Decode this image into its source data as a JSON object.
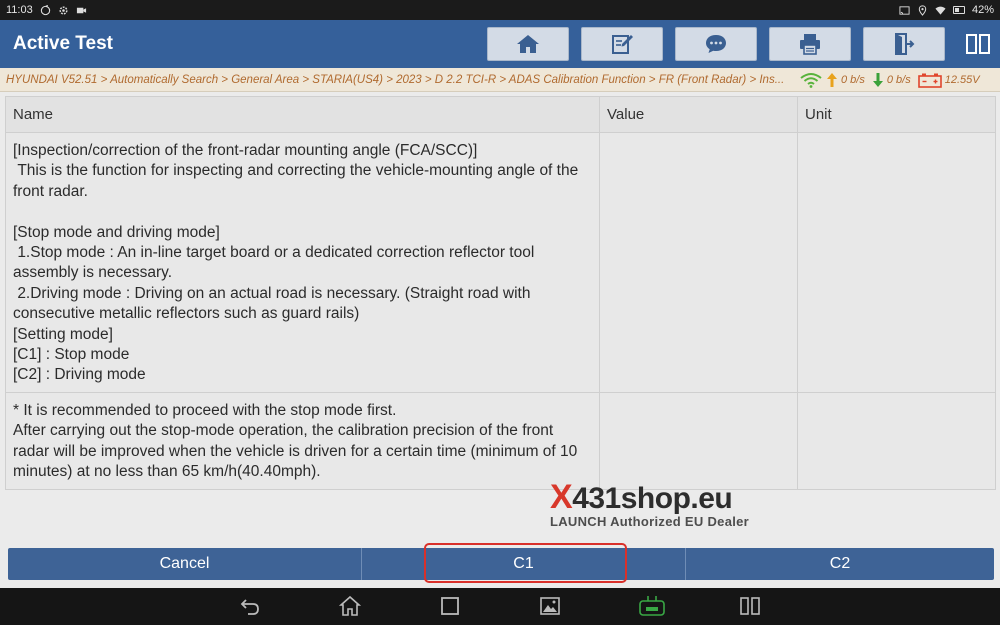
{
  "status_bar": {
    "time": "11:03",
    "battery": "42%"
  },
  "header": {
    "title": "Active Test",
    "toolbar": {
      "home_icon": "home-icon",
      "edit_icon": "edit-note-icon",
      "feedback_icon": "chat-bubble-icon",
      "print_icon": "printer-icon",
      "exit_icon": "exit-icon",
      "split_icon": "split-screen-icon"
    }
  },
  "breadcrumb": {
    "path": "HYUNDAI V52.51 > Automatically Search > General Area > STARIA(US4) > 2023 > D 2.2 TCI-R > ADAS Calibration Function > FR (Front Radar) > Ins...",
    "upload_speed": "0 b/s",
    "download_speed": "0 b/s",
    "voltage": "12.55V"
  },
  "table": {
    "columns": [
      "Name",
      "Value",
      "Unit"
    ],
    "rows": [
      {
        "name": "[Inspection/correction of the front-radar mounting angle (FCA/SCC)]\n This is the function for inspecting and correcting the vehicle-mounting angle of the front radar.\n\n[Stop mode and driving mode]\n 1.Stop mode : An in-line target board or a dedicated correction reflector tool assembly is necessary.\n 2.Driving mode : Driving on an actual road is necessary. (Straight road with consecutive metallic reflectors such as guard rails)\n[Setting mode]\n[C1] : Stop mode\n[C2] : Driving mode",
        "value": "",
        "unit": ""
      },
      {
        "name": "* It is recommended to proceed with the stop mode first.\nAfter carrying out the stop-mode operation, the calibration precision of the front radar will be improved when the vehicle is driven for a certain time (minimum of 10 minutes) at no less than 65 km/h(40.40mph).",
        "value": "",
        "unit": ""
      }
    ]
  },
  "watermark": {
    "brand_x": "X",
    "brand_rest": "431shop.eu",
    "tagline": "LAUNCH Authorized EU Dealer"
  },
  "actions": {
    "cancel": "Cancel",
    "c1": "C1",
    "c2": "C2"
  },
  "colors": {
    "header_bg": "#35609a",
    "breadcrumb_text": "#b06a2f",
    "action_bg": "#3e6396",
    "highlight": "#d9302a",
    "upload_arrow": "#e8a21c",
    "download_arrow": "#3aa13a",
    "wifi": "#58b33b",
    "battery_indicator": "#e0452c"
  }
}
